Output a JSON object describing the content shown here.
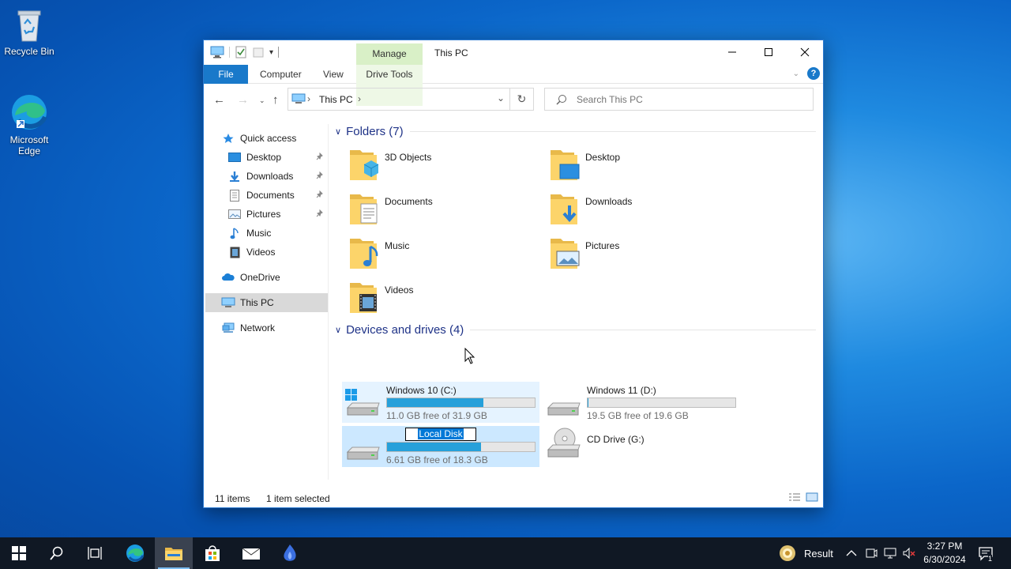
{
  "desktop": {
    "icons": [
      {
        "label": "Recycle Bin"
      },
      {
        "label": "Microsoft Edge"
      }
    ]
  },
  "window": {
    "title": "This PC",
    "contextual_tab": "Manage",
    "ribbon_tabs": [
      "File",
      "Computer",
      "View",
      "Drive Tools"
    ],
    "address": {
      "crumb": "This PC",
      "separator": "›"
    },
    "search": {
      "placeholder": "Search This PC"
    }
  },
  "sidebar": {
    "items": [
      {
        "label": "Quick access"
      },
      {
        "label": "Desktop"
      },
      {
        "label": "Downloads"
      },
      {
        "label": "Documents"
      },
      {
        "label": "Pictures"
      },
      {
        "label": "Music"
      },
      {
        "label": "Videos"
      },
      {
        "label": "OneDrive"
      },
      {
        "label": "This PC"
      },
      {
        "label": "Network"
      }
    ]
  },
  "folders": {
    "header": "Folders (7)",
    "items": [
      {
        "name": "3D Objects"
      },
      {
        "name": "Desktop"
      },
      {
        "name": "Documents"
      },
      {
        "name": "Downloads"
      },
      {
        "name": "Music"
      },
      {
        "name": "Pictures"
      },
      {
        "name": "Videos"
      }
    ]
  },
  "drives": {
    "header": "Devices and drives (4)",
    "items": [
      {
        "name": "Windows 10 (C:)",
        "free_text": "11.0 GB free of 31.9 GB",
        "used_fraction": 0.655
      },
      {
        "name": "Windows 11 (D:)",
        "free_text": "19.5 GB free of 19.6 GB",
        "used_fraction": 0.005
      },
      {
        "name": "Local Disk",
        "free_text": "6.61 GB free of 18.3 GB",
        "used_fraction": 0.639
      },
      {
        "name": "CD Drive (G:)"
      }
    ]
  },
  "status": {
    "items": "11 items",
    "selection": "1 item selected"
  },
  "taskbar": {
    "tray_label": "Result",
    "time": "3:27 PM",
    "date": "6/30/2024",
    "notification_count": "1"
  },
  "colors": {
    "accent": "#1979ca",
    "drive_bar": "#26a0da",
    "selection": "#cce8ff",
    "manage_tab": "#d9f0c7"
  }
}
